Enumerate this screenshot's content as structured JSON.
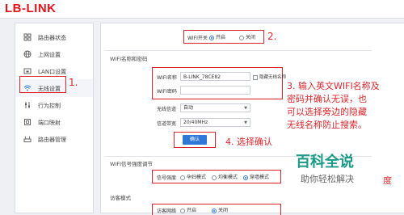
{
  "brand": {
    "logo_text": "LB-LINK"
  },
  "sidebar": {
    "items": [
      {
        "label": "路由器状态",
        "icon": "grid-icon"
      },
      {
        "label": "上网设置",
        "icon": "globe-icon"
      },
      {
        "label": "LAN口设置",
        "icon": "lan-icon"
      },
      {
        "label": "无线设置",
        "icon": "wifi-icon",
        "active": true
      },
      {
        "label": "行为控制",
        "icon": "controls-icon"
      },
      {
        "label": "端口映射",
        "icon": "port-icon"
      },
      {
        "label": "路由器管理",
        "icon": "router-icon"
      }
    ]
  },
  "wifi_switch": {
    "label": "WIFI开关",
    "on": "开启",
    "off": "关闭"
  },
  "wifi_name_section": {
    "title": "WIFI名称和密码",
    "name_label": "WIFI名称",
    "name_value": "B-LINK_78CE82",
    "hide_label": "隐藏无线名称",
    "password_label": "WIFI密码",
    "password_value": "",
    "encryption_label": "无线信道",
    "encryption_value": "自动",
    "bandwidth_label": "信道带宽",
    "bandwidth_value": "20/40MHz",
    "confirm_label": "确认"
  },
  "signal_section": {
    "title": "WIFI信号强度调节",
    "strength_label": "信号强度",
    "options": [
      "孕妇模式",
      "均衡模式",
      "穿墙模式"
    ]
  },
  "visitor_section": {
    "title": "访客模式",
    "row_label": "访客网络",
    "on": "开启",
    "off": "关闭"
  },
  "annotations": {
    "step1": "1.",
    "step2": "2.",
    "step3": "3. 输入英文WIFI名称及\n密码并确认无误，也\n可以选择旁边的隐藏\n无线名称防止搜索。",
    "step4": "4.  选择确认",
    "edge_char": "度"
  },
  "watermark": {
    "title": "百科全说",
    "subtitle": "助你轻松解决"
  },
  "colors": {
    "brand_red": "#e4141b",
    "annotation_red": "#d9262c",
    "primary_blue": "#2f78d8",
    "watermark_green": "#1a9a86"
  }
}
